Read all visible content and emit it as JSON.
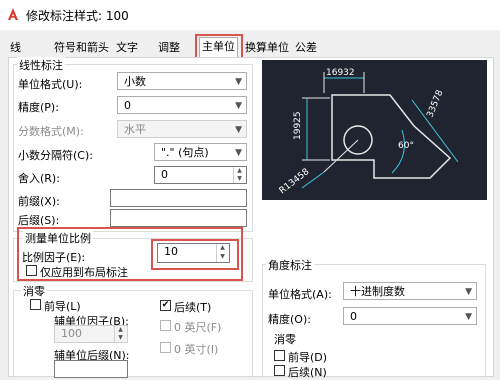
{
  "window": {
    "title": "修改标注样式: 100"
  },
  "tabs": [
    {
      "label": "线"
    },
    {
      "label": "符号和箭头"
    },
    {
      "label": "文字"
    },
    {
      "label": "调整"
    },
    {
      "label": "主单位"
    },
    {
      "label": "换算单位"
    },
    {
      "label": "公差"
    }
  ],
  "linear": {
    "group_title": "线性标注",
    "unit_format_label": "单位格式(U):",
    "unit_format_value": "小数",
    "precision_label": "精度(P):",
    "precision_value": "0",
    "fraction_format_label": "分数格式(M):",
    "fraction_format_value": "水平",
    "decimal_sep_label": "小数分隔符(C):",
    "decimal_sep_value": "\".\" (句点)",
    "round_off_label": "舍入(R):",
    "round_off_value": "0",
    "prefix_label": "前缀(X):",
    "prefix_value": "",
    "suffix_label": "后缀(S):",
    "suffix_value": ""
  },
  "scale": {
    "group_title": "测量单位比例",
    "factor_label": "比例因子(E):",
    "factor_value": "10",
    "layout_only_label": "仅应用到布局标注"
  },
  "zero_suppress": {
    "group_title": "消零",
    "leading_label": "前导(L)",
    "trailing_label": "后续(T)",
    "sub_units_factor_label": "辅单位因子(B):",
    "sub_units_factor_value": "100",
    "sub_units_suffix_label": "辅单位后缀(N):",
    "zero_feet_label": "0 英尺(F)",
    "zero_inches_label": "0 英寸(I)"
  },
  "angular": {
    "group_title": "角度标注",
    "unit_format_label": "单位格式(A):",
    "unit_format_value": "十进制度数",
    "precision_label": "精度(O):",
    "precision_value": "0",
    "zero_group_title": "消零",
    "leading_label": "前导(D)",
    "trailing_label": "后续(N)"
  },
  "preview": {
    "dim_top": "16932",
    "dim_left": "19925",
    "dim_right": "33578",
    "dim_angle": "60°",
    "dim_radius": "R13458"
  },
  "colors": {
    "highlight": "#d9534f",
    "preview_bg": "#1f2430",
    "preview_line": "#e6e6e6",
    "preview_dim": "#3ec6d9"
  }
}
